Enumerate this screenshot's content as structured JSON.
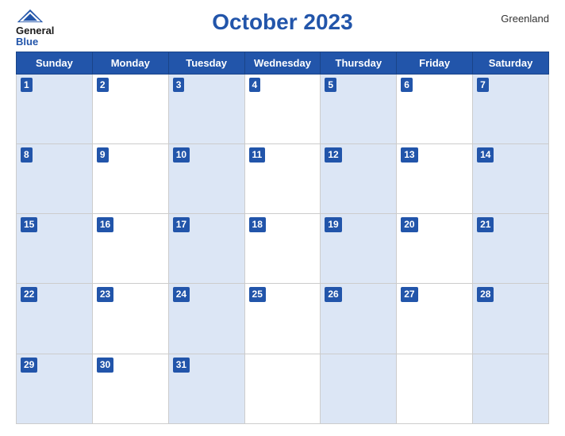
{
  "header": {
    "logo_general": "General",
    "logo_blue": "Blue",
    "title": "October 2023",
    "country": "Greenland"
  },
  "days_of_week": [
    "Sunday",
    "Monday",
    "Tuesday",
    "Wednesday",
    "Thursday",
    "Friday",
    "Saturday"
  ],
  "weeks": [
    [
      {
        "day": "1",
        "shaded": true
      },
      {
        "day": "2",
        "shaded": false
      },
      {
        "day": "3",
        "shaded": true
      },
      {
        "day": "4",
        "shaded": false
      },
      {
        "day": "5",
        "shaded": true
      },
      {
        "day": "6",
        "shaded": false
      },
      {
        "day": "7",
        "shaded": true
      }
    ],
    [
      {
        "day": "8",
        "shaded": true
      },
      {
        "day": "9",
        "shaded": false
      },
      {
        "day": "10",
        "shaded": true
      },
      {
        "day": "11",
        "shaded": false
      },
      {
        "day": "12",
        "shaded": true
      },
      {
        "day": "13",
        "shaded": false
      },
      {
        "day": "14",
        "shaded": true
      }
    ],
    [
      {
        "day": "15",
        "shaded": true
      },
      {
        "day": "16",
        "shaded": false
      },
      {
        "day": "17",
        "shaded": true
      },
      {
        "day": "18",
        "shaded": false
      },
      {
        "day": "19",
        "shaded": true
      },
      {
        "day": "20",
        "shaded": false
      },
      {
        "day": "21",
        "shaded": true
      }
    ],
    [
      {
        "day": "22",
        "shaded": true
      },
      {
        "day": "23",
        "shaded": false
      },
      {
        "day": "24",
        "shaded": true
      },
      {
        "day": "25",
        "shaded": false
      },
      {
        "day": "26",
        "shaded": true
      },
      {
        "day": "27",
        "shaded": false
      },
      {
        "day": "28",
        "shaded": true
      }
    ],
    [
      {
        "day": "29",
        "shaded": true
      },
      {
        "day": "30",
        "shaded": false
      },
      {
        "day": "31",
        "shaded": true
      },
      {
        "day": "",
        "shaded": false
      },
      {
        "day": "",
        "shaded": true
      },
      {
        "day": "",
        "shaded": false
      },
      {
        "day": "",
        "shaded": true
      }
    ]
  ]
}
